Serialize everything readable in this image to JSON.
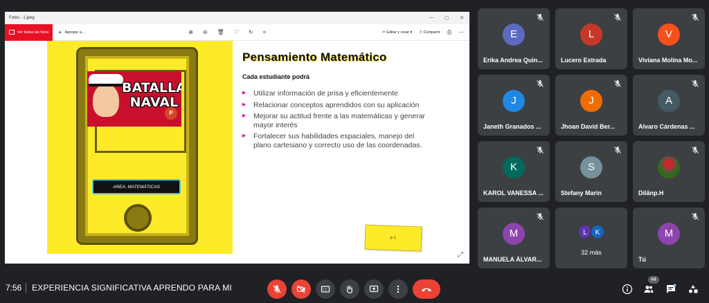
{
  "photos_window": {
    "title": "Fotos - 1.jpeg",
    "win_min": "—",
    "win_max": "▢",
    "win_close": "✕",
    "view_all_label": "Ver todas las fotos",
    "add_label": "Agregar a...",
    "edit_label": "Editar y crear",
    "share_label": "Compartir"
  },
  "slide": {
    "title": "Pensamiento Matemático",
    "subtitle": "Cada estudiante podrá",
    "bullets": [
      "Utilizar información de prisa y eficientemente",
      "Relacionar conceptos aprendidos con su aplicación",
      "Mejorar su actitud frente a las matemáticas y generar mayor interés",
      "Fortalecer sus habilidades espaciales, manejo del plano cartesiano y correcto uso de las coordenadas."
    ],
    "batalla_text": "BATALLA NAVAL",
    "area_label": "AREA: MATEMÁTICAS",
    "ppt_badge": "P",
    "note_label": "p 1"
  },
  "participants": [
    {
      "initial": "E",
      "name": "Erika Andrea Quin...",
      "color": "#5c6bc0"
    },
    {
      "initial": "L",
      "name": "Lucero Estrada",
      "color": "#c53929"
    },
    {
      "initial": "V",
      "name": "Viviana Molina Mo...",
      "color": "#f4511e"
    },
    {
      "initial": "J",
      "name": "Janeth Granados ...",
      "color": "#1e88e5"
    },
    {
      "initial": "J",
      "name": "Jhoan David Ber...",
      "color": "#ef6c00"
    },
    {
      "initial": "A",
      "name": "Alvaro Cárdenas ...",
      "color": "#455a64"
    },
    {
      "initial": "K",
      "name": "KAROL VANESSA ...",
      "color": "#00695c"
    },
    {
      "initial": "S",
      "name": "Stefany Marin",
      "color": "#78909c"
    },
    {
      "initial": "",
      "name": "Dilānp.H",
      "color": "#33691e"
    },
    {
      "initial": "M",
      "name": "MANUELA ÁLVAR...",
      "color": "#8e44ad"
    },
    {
      "initial": "",
      "name": "",
      "color": ""
    },
    {
      "initial": "M",
      "name": "Tú",
      "color": "#8e44ad"
    }
  ],
  "more_tile": {
    "label": "32 más",
    "mini_1": "L",
    "mini_1_color": "#5e35b1",
    "mini_2": "K",
    "mini_2_color": "#1565c0"
  },
  "meeting": {
    "time": "7:56",
    "title": "EXPERIENCIA SIGNIFICATIVA APRENDO PARA MI",
    "participant_count": "44"
  },
  "colors": {
    "accent_red": "#ea4335",
    "tile_bg": "#3c4043",
    "background": "#202124",
    "slide_yellow": "#fdeb2a"
  }
}
